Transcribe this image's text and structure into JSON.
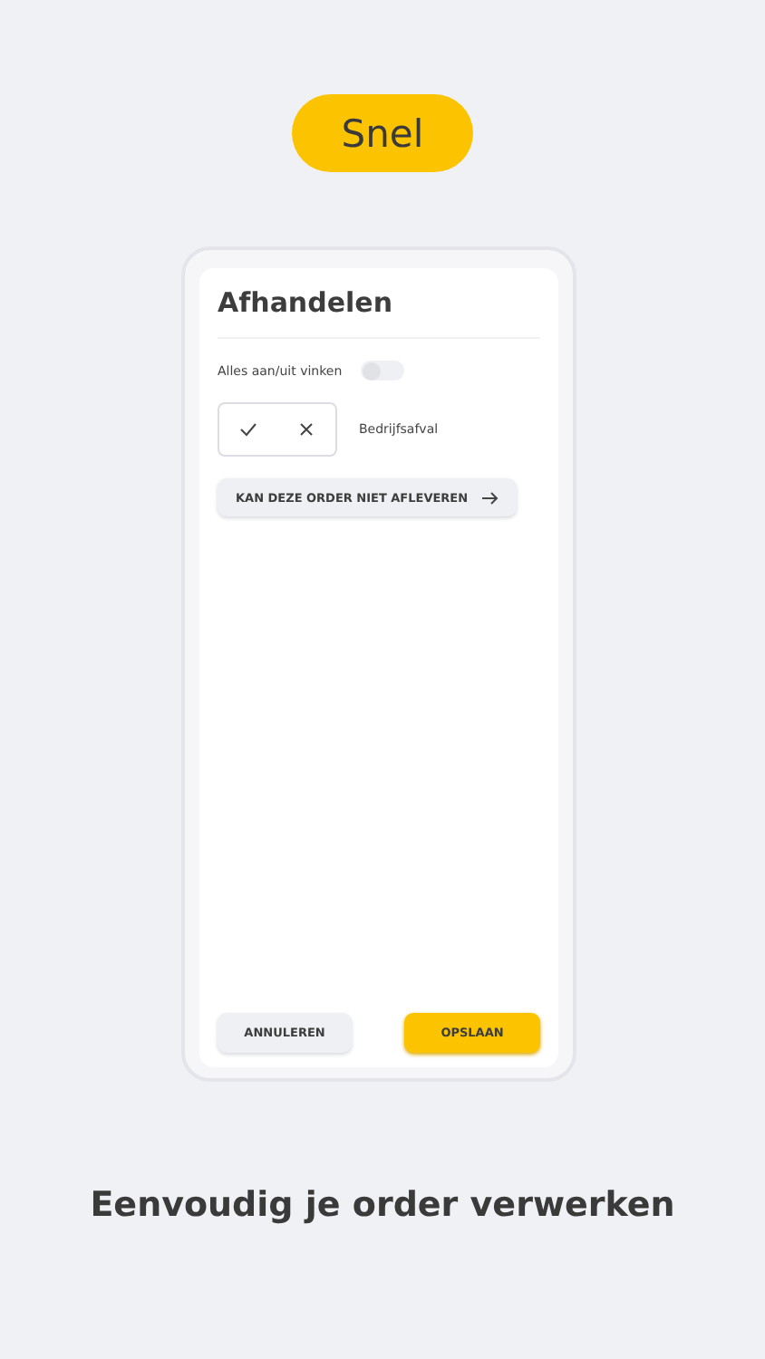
{
  "badge": "Snel",
  "screen": {
    "title": "Afhandelen",
    "toggle_all": {
      "label": "Alles aan/uit vinken",
      "on": false
    },
    "items": [
      {
        "label": "Bedrijfsafval"
      }
    ],
    "not_deliver_button": "KAN DEZE ORDER NIET AFLEVEREN",
    "buttons": [
      {
        "label": "ANNULEREN",
        "kind": "secondary"
      },
      {
        "label": "OPSLAAN",
        "kind": "primary"
      }
    ]
  },
  "caption": "Eenvoudig je order verwerken"
}
